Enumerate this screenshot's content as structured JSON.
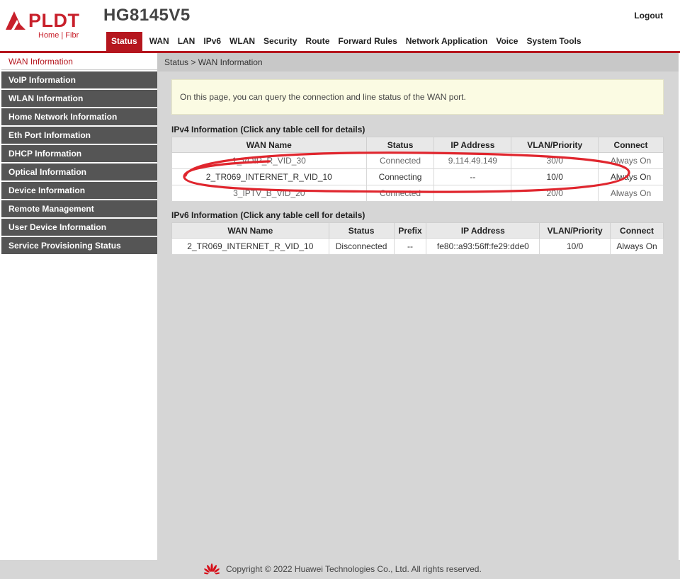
{
  "brand": {
    "logo_text": "PLDT",
    "logo_sub": "Home | Fibr",
    "device_model": "HG8145V5",
    "accent_color": "#b5161e"
  },
  "header": {
    "logout_label": "Logout",
    "nav": [
      "Status",
      "WAN",
      "LAN",
      "IPv6",
      "WLAN",
      "Security",
      "Route",
      "Forward Rules",
      "Network Application",
      "Voice",
      "System Tools"
    ],
    "active_nav": "Status"
  },
  "sidebar": {
    "items": [
      {
        "label": "WAN Information",
        "active": true
      },
      {
        "label": "VoIP Information"
      },
      {
        "label": "WLAN Information"
      },
      {
        "label": "Home Network Information"
      },
      {
        "label": "Eth Port Information"
      },
      {
        "label": "DHCP Information"
      },
      {
        "label": "Optical Information"
      },
      {
        "label": "Device Information"
      },
      {
        "label": "Remote Management"
      },
      {
        "label": "User Device Information"
      },
      {
        "label": "Service Provisioning Status"
      }
    ]
  },
  "main": {
    "breadcrumb": "Status > WAN Information",
    "notice": "On this page, you can query the connection and line status of the WAN port.",
    "ipv4": {
      "title": "IPv4 Information (Click any table cell for details)",
      "columns": [
        "WAN Name",
        "Status",
        "IP Address",
        "VLAN/Priority",
        "Connect"
      ],
      "rows": [
        [
          "1_VOIP_R_VID_30",
          "Connected",
          "9.114.49.149",
          "30/0",
          "Always On"
        ],
        [
          "2_TR069_INTERNET_R_VID_10",
          "Connecting",
          "--",
          "10/0",
          "Always On"
        ],
        [
          "3_IPTV_B_VID_20",
          "Connected",
          "",
          "20/0",
          "Always On"
        ]
      ]
    },
    "ipv6": {
      "title": "IPv6 Information (Click any table cell for details)",
      "columns": [
        "WAN Name",
        "Status",
        "Prefix",
        "IP Address",
        "VLAN/Priority",
        "Connect"
      ],
      "rows": [
        [
          "2_TR069_INTERNET_R_VID_10",
          "Disconnected",
          "--",
          "fe80::a93:56ff:fe29:dde0",
          "10/0",
          "Always On"
        ]
      ]
    }
  },
  "footer": {
    "copyright": "Copyright © 2022 Huawei Technologies Co., Ltd. All rights reserved.",
    "logo_icon": "huawei-logo-icon"
  },
  "annotation_color": "#e0262e"
}
